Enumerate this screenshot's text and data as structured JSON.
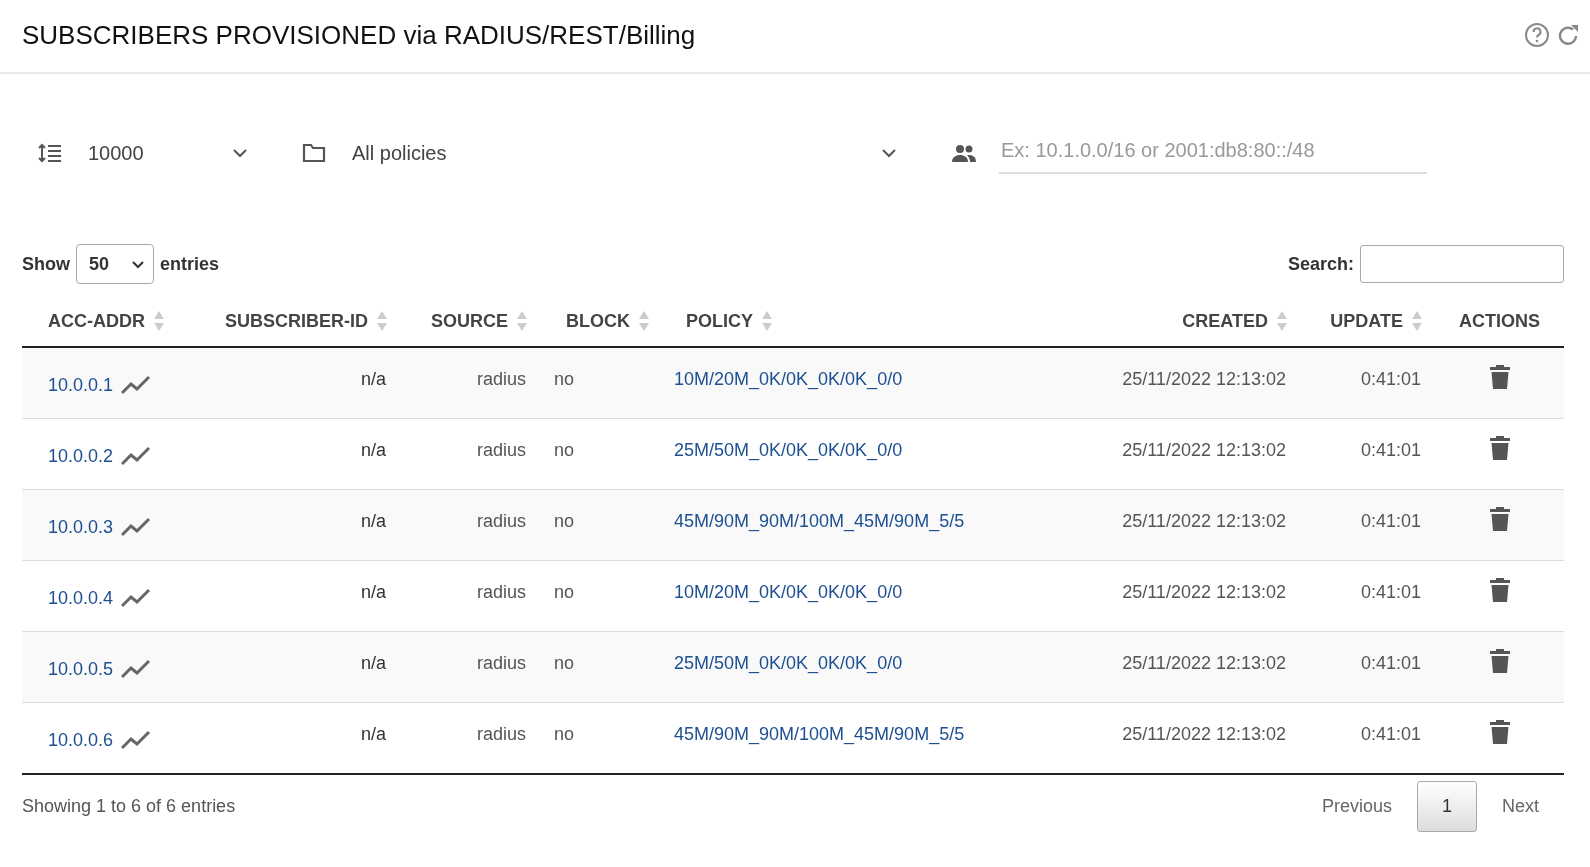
{
  "header": {
    "title": "SUBSCRIBERS PROVISIONED via RADIUS/REST/Billing"
  },
  "filters": {
    "max_rows": "10000",
    "policy": "All policies",
    "subnet_placeholder": "Ex: 10.1.0.0/16 or 2001:db8:80::/48"
  },
  "length_control": {
    "label_before": "Show",
    "value": "50",
    "label_after": "entries"
  },
  "search": {
    "label": "Search:"
  },
  "table": {
    "columns": [
      {
        "label": "ACC-ADDR",
        "sortable": true
      },
      {
        "label": "SUBSCRIBER-ID",
        "sortable": true
      },
      {
        "label": "SOURCE",
        "sortable": true
      },
      {
        "label": "BLOCK",
        "sortable": true
      },
      {
        "label": "POLICY",
        "sortable": true
      },
      {
        "label": "CREATED",
        "sortable": true
      },
      {
        "label": "UPDATE",
        "sortable": true
      },
      {
        "label": "ACTIONS",
        "sortable": false
      }
    ],
    "rows": [
      {
        "acc_addr": "10.0.0.1",
        "subscriber_id": "n/a",
        "source": "radius",
        "block": "no",
        "policy": "10M/20M_0K/0K_0K/0K_0/0",
        "created": "25/11/2022 12:13:02",
        "update": "0:41:01"
      },
      {
        "acc_addr": "10.0.0.2",
        "subscriber_id": "n/a",
        "source": "radius",
        "block": "no",
        "policy": "25M/50M_0K/0K_0K/0K_0/0",
        "created": "25/11/2022 12:13:02",
        "update": "0:41:01"
      },
      {
        "acc_addr": "10.0.0.3",
        "subscriber_id": "n/a",
        "source": "radius",
        "block": "no",
        "policy": "45M/90M_90M/100M_45M/90M_5/5",
        "created": "25/11/2022 12:13:02",
        "update": "0:41:01"
      },
      {
        "acc_addr": "10.0.0.4",
        "subscriber_id": "n/a",
        "source": "radius",
        "block": "no",
        "policy": "10M/20M_0K/0K_0K/0K_0/0",
        "created": "25/11/2022 12:13:02",
        "update": "0:41:01"
      },
      {
        "acc_addr": "10.0.0.5",
        "subscriber_id": "n/a",
        "source": "radius",
        "block": "no",
        "policy": "25M/50M_0K/0K_0K/0K_0/0",
        "created": "25/11/2022 12:13:02",
        "update": "0:41:01"
      },
      {
        "acc_addr": "10.0.0.6",
        "subscriber_id": "n/a",
        "source": "radius",
        "block": "no",
        "policy": "45M/90M_90M/100M_45M/90M_5/5",
        "created": "25/11/2022 12:13:02",
        "update": "0:41:01"
      }
    ]
  },
  "footer": {
    "info": "Showing 1 to 6 of 6 entries",
    "previous": "Previous",
    "pages": [
      {
        "label": "1",
        "selected": true
      }
    ],
    "next": "Next"
  }
}
